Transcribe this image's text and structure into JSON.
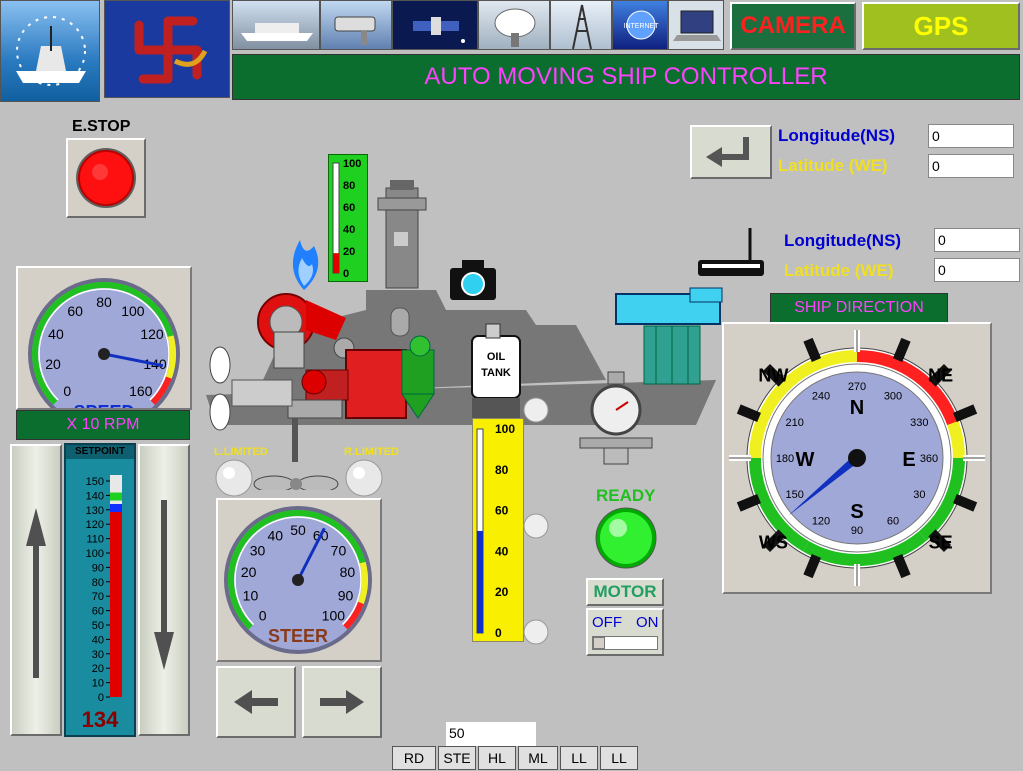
{
  "header": {
    "title": "AUTO MOVING SHIP CONTROLLER",
    "camera_button": "CAMERA",
    "gps_button": "GPS",
    "internet_label": "INTERNET"
  },
  "estop": {
    "label": "E.STOP"
  },
  "gps_panel_1": {
    "longitude_label": "Longitude(NS)",
    "longitude_value": "0",
    "latitude_label": "Latitude (WE)",
    "latitude_value": "0"
  },
  "gps_panel_2": {
    "longitude_label": "Longitude(NS)",
    "longitude_value": "0",
    "latitude_label": "Latitude (WE)",
    "latitude_value": "0"
  },
  "speed_gauge": {
    "label": "SPEED",
    "unit": "X 10 RPM",
    "ticks": [
      "0",
      "20",
      "40",
      "60",
      "80",
      "100",
      "120",
      "140",
      "160"
    ],
    "value": 140
  },
  "setpoint": {
    "title": "SETPOINT",
    "ticks": [
      "150",
      "140",
      "130",
      "120",
      "110",
      "100",
      "90",
      "80",
      "70",
      "60",
      "50",
      "40",
      "30",
      "20",
      "10",
      "0"
    ],
    "value": "134",
    "level": 134
  },
  "steer_gauge": {
    "label": "STEER",
    "ticks": [
      "0",
      "10",
      "20",
      "30",
      "40",
      "50",
      "60",
      "70",
      "80",
      "90",
      "100"
    ],
    "value": 60
  },
  "limits": {
    "left": "L.LIMITED",
    "right": "R.LIMITED"
  },
  "temperature": {
    "ticks": [
      "100",
      "80",
      "60",
      "40",
      "20",
      "0"
    ],
    "level": 18
  },
  "oil_tank": {
    "label_line1": "OIL",
    "label_line2": "TANK",
    "ticks": [
      "100",
      "80",
      "60",
      "40",
      "20",
      "0"
    ],
    "level": 50
  },
  "ready": {
    "label": "READY"
  },
  "motor": {
    "label": "MOTOR",
    "off": "OFF",
    "on": "ON"
  },
  "ship_direction": {
    "label": "SHIP DIRECTION",
    "cardinals": [
      "N",
      "E",
      "S",
      "W"
    ],
    "intercardinals": [
      "NW",
      "NE",
      "SE",
      "WS"
    ],
    "degree_ticks": [
      "270",
      "300",
      "330",
      "360",
      "30",
      "60",
      "90",
      "120",
      "150",
      "180",
      "210",
      "240"
    ],
    "heading": 140
  },
  "bottom": {
    "input_value": "50",
    "tabs": [
      "RD",
      "STE",
      "HL",
      "ML",
      "LL",
      "LL"
    ]
  },
  "colors": {
    "title_bg": "#0b6e2e",
    "title_fg": "#ff40ff",
    "camera_bg": "#1b6e3e",
    "camera_fg": "#ff2020",
    "gps_bg": "#a0c020",
    "gps_fg": "#ffff00",
    "gauge_face": "#a0a8d8"
  }
}
